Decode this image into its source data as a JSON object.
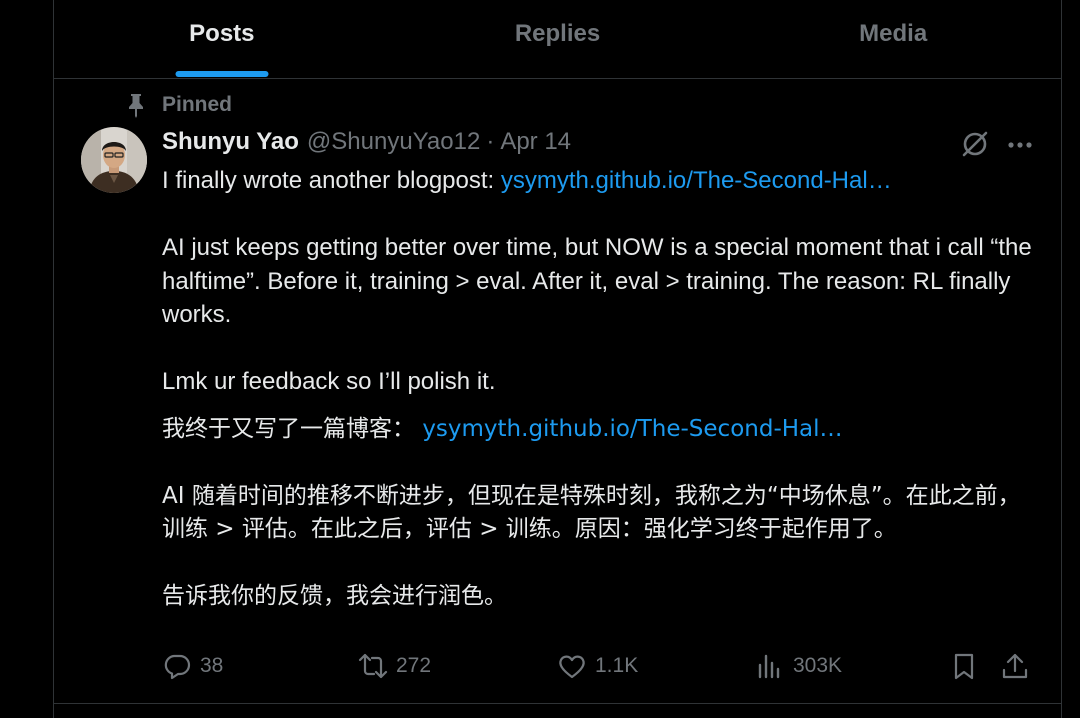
{
  "tabs": [
    {
      "label": "Posts",
      "active": true
    },
    {
      "label": "Replies",
      "active": false
    },
    {
      "label": "Media",
      "active": false
    }
  ],
  "post": {
    "pinned_label": "Pinned",
    "author": {
      "name": "Shunyu Yao",
      "handle": "@ShunyuYao12",
      "separator": "·",
      "date": "Apr 14"
    },
    "text": {
      "p1_prefix": "I finally wrote another blogpost: ",
      "p1_link": "ysymyth.github.io/The-Second-Hal…",
      "p2": "AI just keeps getting better over time, but NOW is a special moment that i call “the halftime”. Before it, training > eval. After it, eval > training. The reason: RL finally works.",
      "p3": "Lmk ur feedback so I’ll polish it.",
      "zh1_prefix": "我终于又写了一篇博客： ",
      "zh1_link": "ysymyth.github.io/The-Second-Hal…",
      "zh2": "AI 随着时间的推移不断进步，但现在是特殊时刻，我称之为“中场休息”。在此之前，训练 > 评估。在此之后，评估 > 训练。原因：强化学习终于起作用了。",
      "zh3": "告诉我你的反馈，我会进行润色。"
    },
    "stats": {
      "replies": "38",
      "reposts": "272",
      "likes": "1.1K",
      "views": "303K"
    }
  },
  "colors": {
    "background": "#000000",
    "text": "#e7e9ea",
    "muted": "#71767b",
    "accent": "#1d9bf0",
    "border": "#2f3336"
  },
  "icons": [
    "pin-icon",
    "grok-icon",
    "more-icon",
    "reply-icon",
    "repost-icon",
    "like-icon",
    "views-icon",
    "bookmark-icon",
    "share-icon"
  ]
}
